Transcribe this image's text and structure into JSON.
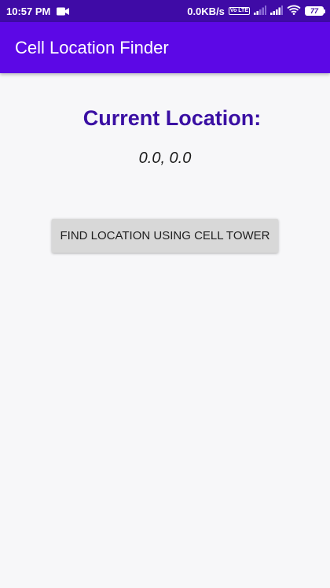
{
  "status_bar": {
    "time": "10:57 PM",
    "network_speed": "0.0KB/s",
    "volte_label": "Vo LTE",
    "battery_level": "77",
    "icons": [
      "video-camera-icon",
      "volte-icon",
      "signal-icon",
      "signal-icon",
      "wifi-icon",
      "battery-icon"
    ]
  },
  "app_bar": {
    "title": "Cell Location Finder",
    "color": "#5c08e6"
  },
  "main": {
    "heading": "Current Location:",
    "coordinates": "0.0, 0.0",
    "find_button_label": "FIND LOCATION USING CELL TOWER"
  },
  "colors": {
    "status_bar": "#3f0ba6",
    "heading": "#3a0fa3",
    "button": "#d8d8d8",
    "background": "#f7f7f9"
  }
}
